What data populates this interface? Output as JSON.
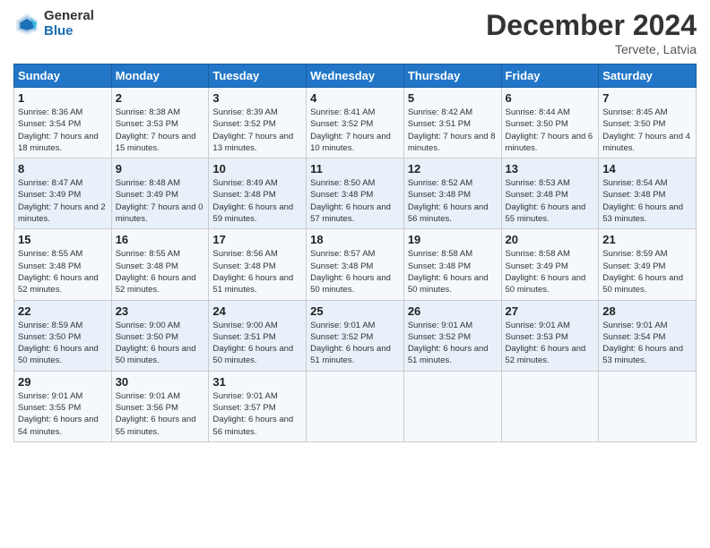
{
  "app": {
    "logo_line1": "General",
    "logo_line2": "Blue"
  },
  "header": {
    "title": "December 2024",
    "location": "Tervete, Latvia"
  },
  "weekdays": [
    "Sunday",
    "Monday",
    "Tuesday",
    "Wednesday",
    "Thursday",
    "Friday",
    "Saturday"
  ],
  "weeks": [
    [
      {
        "day": "1",
        "sunrise": "8:36 AM",
        "sunset": "3:54 PM",
        "daylight": "7 hours and 18 minutes."
      },
      {
        "day": "2",
        "sunrise": "8:38 AM",
        "sunset": "3:53 PM",
        "daylight": "7 hours and 15 minutes."
      },
      {
        "day": "3",
        "sunrise": "8:39 AM",
        "sunset": "3:52 PM",
        "daylight": "7 hours and 13 minutes."
      },
      {
        "day": "4",
        "sunrise": "8:41 AM",
        "sunset": "3:52 PM",
        "daylight": "7 hours and 10 minutes."
      },
      {
        "day": "5",
        "sunrise": "8:42 AM",
        "sunset": "3:51 PM",
        "daylight": "7 hours and 8 minutes."
      },
      {
        "day": "6",
        "sunrise": "8:44 AM",
        "sunset": "3:50 PM",
        "daylight": "7 hours and 6 minutes."
      },
      {
        "day": "7",
        "sunrise": "8:45 AM",
        "sunset": "3:50 PM",
        "daylight": "7 hours and 4 minutes."
      }
    ],
    [
      {
        "day": "8",
        "sunrise": "8:47 AM",
        "sunset": "3:49 PM",
        "daylight": "7 hours and 2 minutes."
      },
      {
        "day": "9",
        "sunrise": "8:48 AM",
        "sunset": "3:49 PM",
        "daylight": "7 hours and 0 minutes."
      },
      {
        "day": "10",
        "sunrise": "8:49 AM",
        "sunset": "3:48 PM",
        "daylight": "6 hours and 59 minutes."
      },
      {
        "day": "11",
        "sunrise": "8:50 AM",
        "sunset": "3:48 PM",
        "daylight": "6 hours and 57 minutes."
      },
      {
        "day": "12",
        "sunrise": "8:52 AM",
        "sunset": "3:48 PM",
        "daylight": "6 hours and 56 minutes."
      },
      {
        "day": "13",
        "sunrise": "8:53 AM",
        "sunset": "3:48 PM",
        "daylight": "6 hours and 55 minutes."
      },
      {
        "day": "14",
        "sunrise": "8:54 AM",
        "sunset": "3:48 PM",
        "daylight": "6 hours and 53 minutes."
      }
    ],
    [
      {
        "day": "15",
        "sunrise": "8:55 AM",
        "sunset": "3:48 PM",
        "daylight": "6 hours and 52 minutes."
      },
      {
        "day": "16",
        "sunrise": "8:55 AM",
        "sunset": "3:48 PM",
        "daylight": "6 hours and 52 minutes."
      },
      {
        "day": "17",
        "sunrise": "8:56 AM",
        "sunset": "3:48 PM",
        "daylight": "6 hours and 51 minutes."
      },
      {
        "day": "18",
        "sunrise": "8:57 AM",
        "sunset": "3:48 PM",
        "daylight": "6 hours and 50 minutes."
      },
      {
        "day": "19",
        "sunrise": "8:58 AM",
        "sunset": "3:48 PM",
        "daylight": "6 hours and 50 minutes."
      },
      {
        "day": "20",
        "sunrise": "8:58 AM",
        "sunset": "3:49 PM",
        "daylight": "6 hours and 50 minutes."
      },
      {
        "day": "21",
        "sunrise": "8:59 AM",
        "sunset": "3:49 PM",
        "daylight": "6 hours and 50 minutes."
      }
    ],
    [
      {
        "day": "22",
        "sunrise": "8:59 AM",
        "sunset": "3:50 PM",
        "daylight": "6 hours and 50 minutes."
      },
      {
        "day": "23",
        "sunrise": "9:00 AM",
        "sunset": "3:50 PM",
        "daylight": "6 hours and 50 minutes."
      },
      {
        "day": "24",
        "sunrise": "9:00 AM",
        "sunset": "3:51 PM",
        "daylight": "6 hours and 50 minutes."
      },
      {
        "day": "25",
        "sunrise": "9:01 AM",
        "sunset": "3:52 PM",
        "daylight": "6 hours and 51 minutes."
      },
      {
        "day": "26",
        "sunrise": "9:01 AM",
        "sunset": "3:52 PM",
        "daylight": "6 hours and 51 minutes."
      },
      {
        "day": "27",
        "sunrise": "9:01 AM",
        "sunset": "3:53 PM",
        "daylight": "6 hours and 52 minutes."
      },
      {
        "day": "28",
        "sunrise": "9:01 AM",
        "sunset": "3:54 PM",
        "daylight": "6 hours and 53 minutes."
      }
    ],
    [
      {
        "day": "29",
        "sunrise": "9:01 AM",
        "sunset": "3:55 PM",
        "daylight": "6 hours and 54 minutes."
      },
      {
        "day": "30",
        "sunrise": "9:01 AM",
        "sunset": "3:56 PM",
        "daylight": "6 hours and 55 minutes."
      },
      {
        "day": "31",
        "sunrise": "9:01 AM",
        "sunset": "3:57 PM",
        "daylight": "6 hours and 56 minutes."
      },
      null,
      null,
      null,
      null
    ]
  ]
}
